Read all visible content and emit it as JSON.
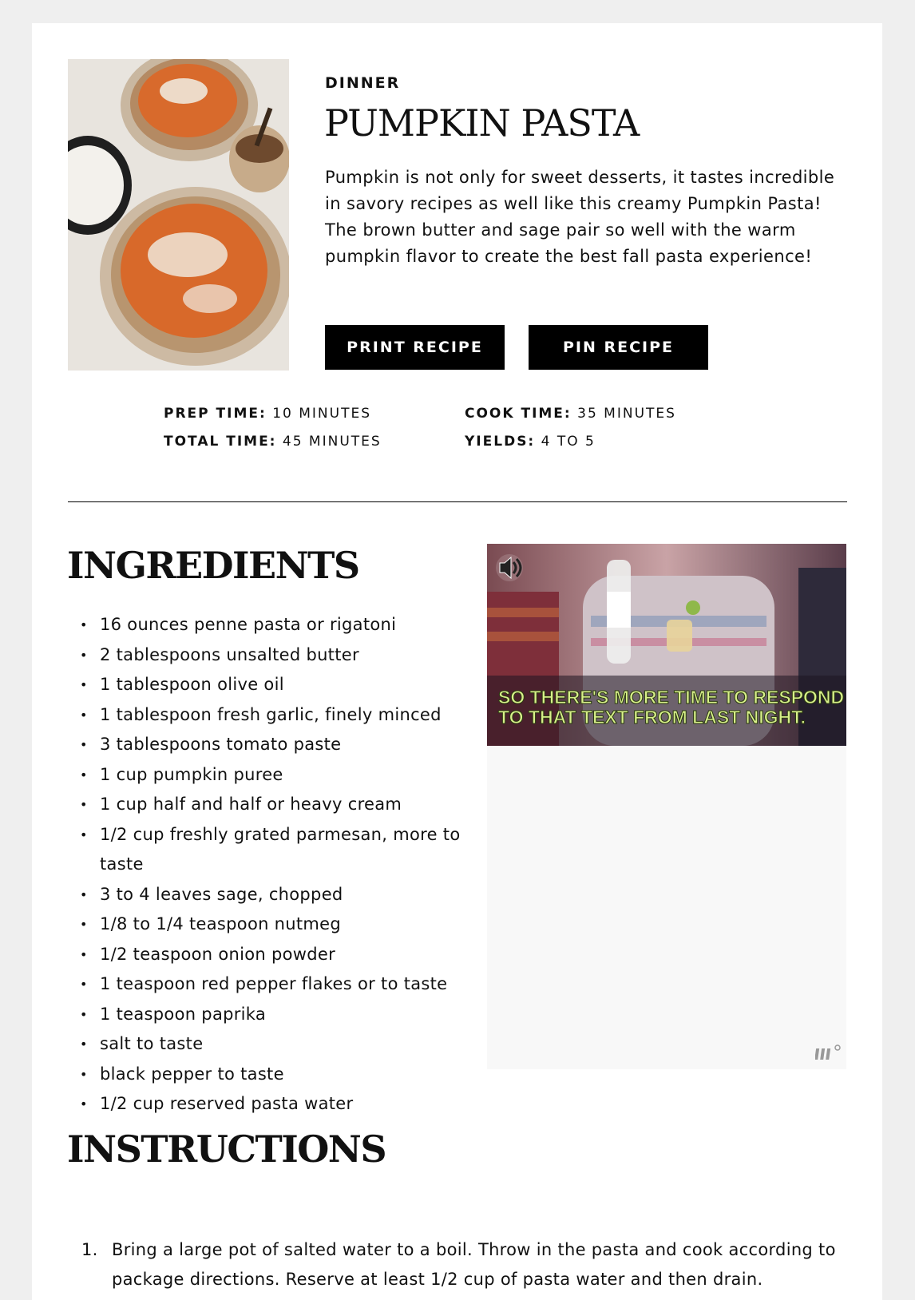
{
  "recipe": {
    "category": "DINNER",
    "title": "PUMPKIN PASTA",
    "description": "Pumpkin is not only for sweet desserts, it tastes incredible in savory recipes as well like this creamy Pumpkin Pasta! The brown butter and sage pair so well with the warm pumpkin flavor to create the best fall pasta experience!",
    "print_label": "PRINT RECIPE",
    "pin_label": "PIN RECIPE"
  },
  "times": {
    "prep_label": "PREP TIME:",
    "prep_value": "10 MINUTES",
    "cook_label": "COOK TIME:",
    "cook_value": "35 MINUTES",
    "total_label": "TOTAL TIME:",
    "total_value": "45 MINUTES",
    "yields_label": "YIELDS:",
    "yields_value": "4 TO 5"
  },
  "ingredients": {
    "heading": "INGREDIENTS",
    "items": [
      "16 ounces penne pasta or rigatoni",
      "2 tablespoons unsalted butter",
      "1 tablespoon olive oil",
      "1 tablespoon fresh garlic, finely minced",
      "3 tablespoons tomato paste",
      "1 cup pumpkin puree",
      "1 cup half and half or heavy cream",
      "1/2 cup freshly grated parmesan, more to taste",
      "3 to 4 leaves sage, chopped",
      "1/8 to 1/4 teaspoon nutmeg",
      "1/2 teaspoon onion powder",
      "1 teaspoon red pepper flakes or to taste",
      "1 teaspoon paprika",
      "salt to taste",
      "black pepper to taste",
      "1/2 cup reserved pasta water"
    ]
  },
  "video_ad": {
    "caption_line1": "SO THERE'S MORE TIME TO RESPOND",
    "caption_line2": "TO THAT TEXT FROM LAST NIGHT.",
    "icon": "speaker-icon",
    "logo": "ad-logo-icon"
  },
  "instructions": {
    "heading": "INSTRUCTIONS",
    "steps": [
      {
        "number": "1.",
        "text": "Bring a large pot of salted water to a boil. Throw in the pasta and cook according to package directions. Reserve at least 1/2 cup of pasta water and then drain."
      }
    ]
  },
  "colors": {
    "page_bg": "#efefef",
    "card_bg": "#ffffff",
    "button_bg": "#000000",
    "caption_green": "#d8f08a"
  }
}
